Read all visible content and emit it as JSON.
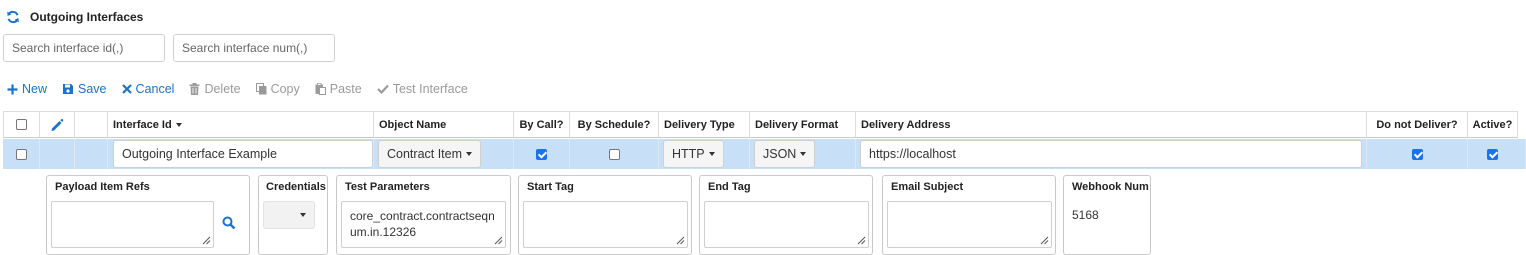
{
  "header": {
    "title": "Outgoing Interfaces",
    "refresh_icon": "refresh-icon"
  },
  "search": {
    "interface_id_placeholder": "Search interface id(,)",
    "interface_num_placeholder": "Search interface num(,)"
  },
  "toolbar": {
    "new_label": "New",
    "save_label": "Save",
    "cancel_label": "Cancel",
    "delete_label": "Delete",
    "copy_label": "Copy",
    "paste_label": "Paste",
    "test_label": "Test Interface"
  },
  "grid": {
    "columns": {
      "interface_id": "Interface Id",
      "object_name": "Object Name",
      "by_call": "By Call?",
      "by_schedule": "By Schedule?",
      "delivery_type": "Delivery Type",
      "delivery_format": "Delivery Format",
      "delivery_address": "Delivery Address",
      "do_not_deliver": "Do not Deliver?",
      "active": "Active?"
    },
    "row": {
      "selected": false,
      "interface_id": "Outgoing Interface Example",
      "object_name": "Contract Item",
      "by_call": true,
      "by_schedule": false,
      "delivery_type": "HTTP",
      "delivery_format": "JSON",
      "delivery_address": "https://localhost",
      "do_not_deliver": true,
      "active": true
    }
  },
  "detail": {
    "payload_item_refs_label": "Payload Item Refs",
    "payload_item_refs_value": "",
    "credentials_label": "Credentials",
    "credentials_value": "",
    "test_parameters_label": "Test Parameters",
    "test_parameters_value": "core_contract.contractseqnum.in.12326",
    "start_tag_label": "Start Tag",
    "start_tag_value": "",
    "end_tag_label": "End Tag",
    "end_tag_value": "",
    "email_subject_label": "Email Subject",
    "email_subject_value": "",
    "webhook_num_label": "Webhook Num",
    "webhook_num_value": "5168"
  },
  "colors": {
    "accent": "#1a73c8",
    "row_selected": "#c7e0f8",
    "disabled": "#9a9a9a"
  }
}
